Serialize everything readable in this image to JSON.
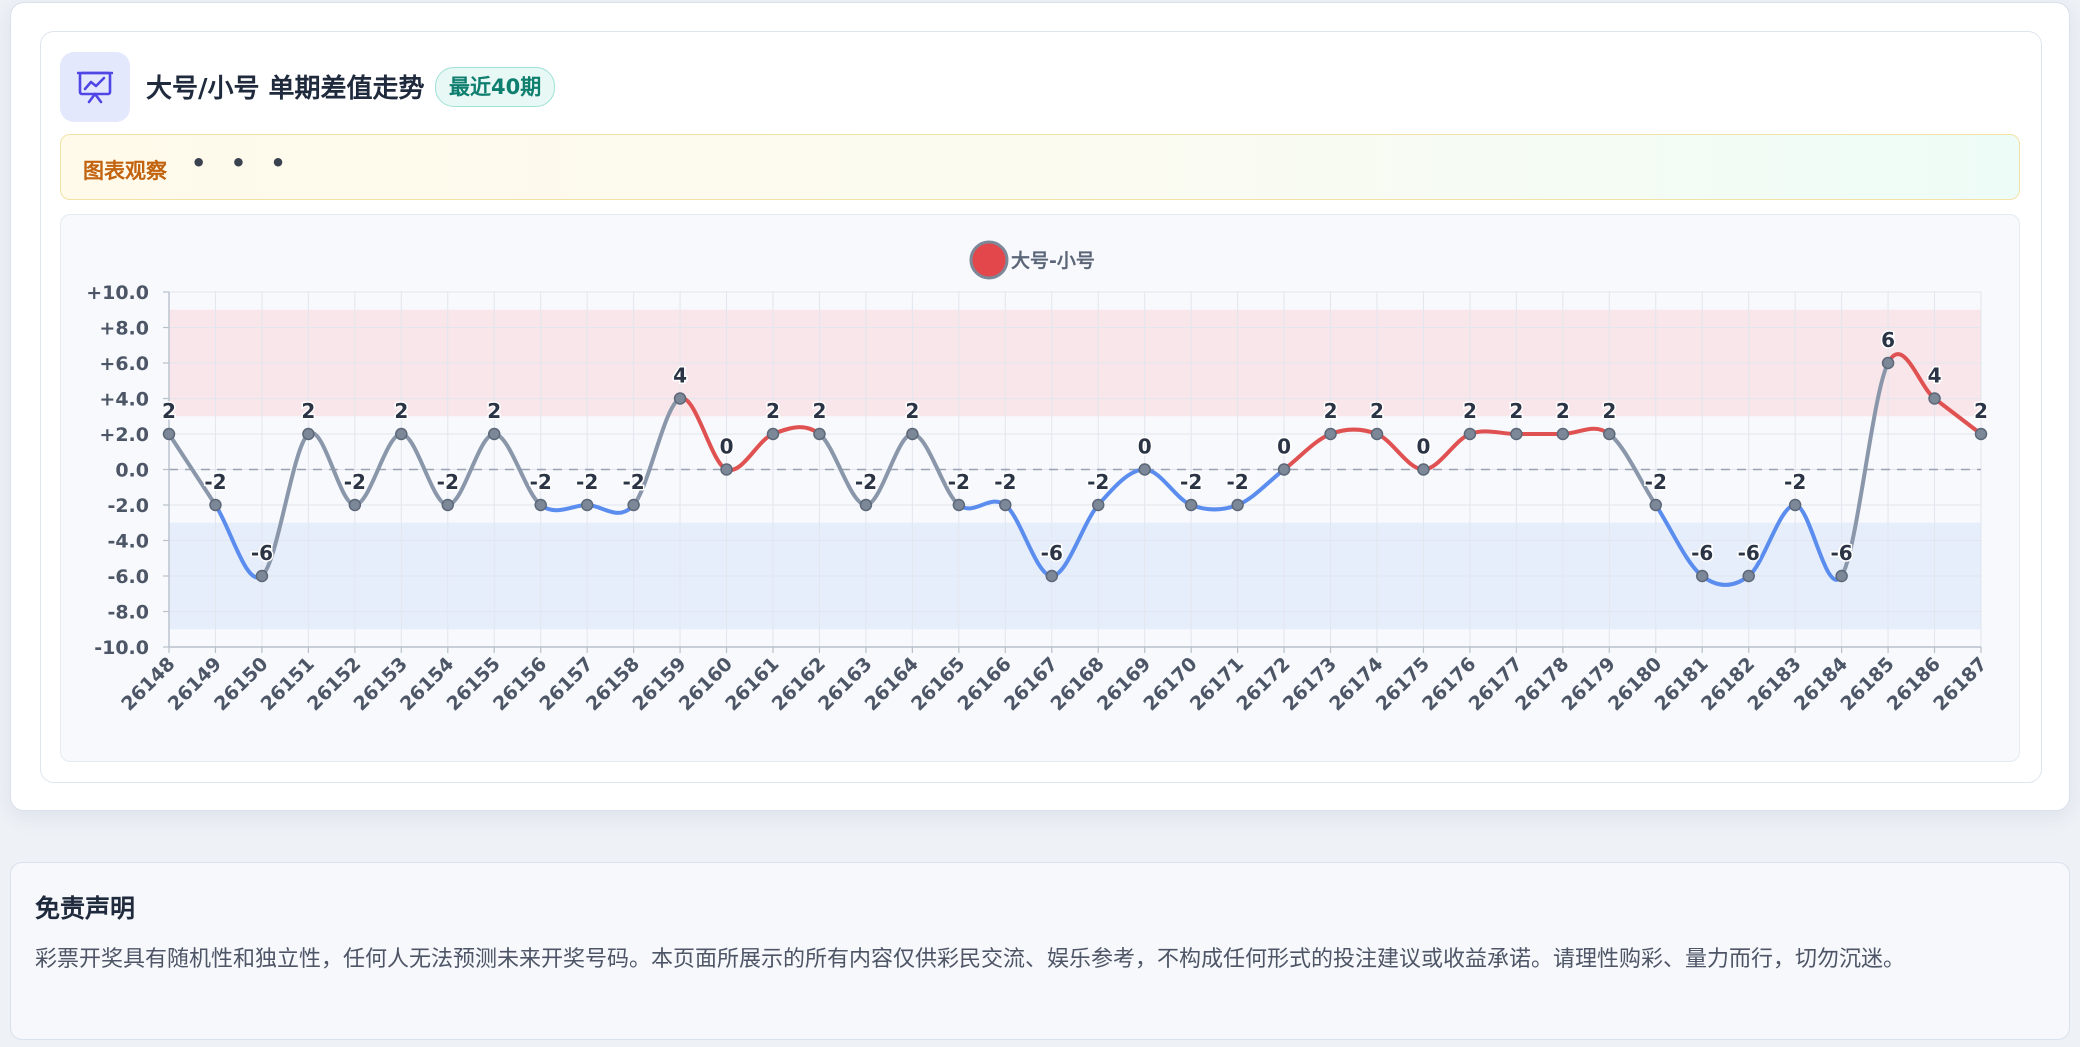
{
  "header": {
    "title": "大号/小号 单期差值走势",
    "badge": "最近40期",
    "icon": "chart-presentation-icon"
  },
  "observation": {
    "label": "图表观察",
    "dots": "• • •"
  },
  "disclaimer": {
    "title": "免责声明",
    "text": "彩票开奖具有随机性和独立性，任何人无法预测未来开奖号码。本页面所展示的所有内容仅供彩民交流、娱乐参考，不构成任何形式的投注建议或收益承诺。请理性购彩、量力而行，切勿沉迷。"
  },
  "colors": {
    "positive": "#e05252",
    "negative": "#5b8def",
    "neutral": "#8a97aa",
    "positive_band": "#f9e6ea",
    "negative_band": "#e7eefb",
    "zero_line": "#9aa3b2",
    "legend_fill": "#e3474b"
  },
  "chart_data": {
    "type": "line",
    "title": "",
    "xlabel": "",
    "ylabel": "",
    "legend": "大号-小号",
    "legend_position": "top",
    "ylim": [
      -10,
      10
    ],
    "y_tick_step": 2,
    "y_tick_labels": [
      "+10.0",
      "+8.0",
      "+6.0",
      "+4.0",
      "+2.0",
      "0.0",
      "-2.0",
      "-4.0",
      "-6.0",
      "-8.0",
      "-10.0"
    ],
    "bands": [
      {
        "from": 3,
        "to": 9,
        "color": "#f9e6ea"
      },
      {
        "from": -9,
        "to": -3,
        "color": "#e7eefb"
      }
    ],
    "grid": true,
    "x": [
      "26148",
      "26149",
      "26150",
      "26151",
      "26152",
      "26153",
      "26154",
      "26155",
      "26156",
      "26157",
      "26158",
      "26159",
      "26160",
      "26161",
      "26162",
      "26163",
      "26164",
      "26165",
      "26166",
      "26167",
      "26168",
      "26169",
      "26170",
      "26171",
      "26172",
      "26173",
      "26174",
      "26175",
      "26176",
      "26177",
      "26178",
      "26179",
      "26180",
      "26181",
      "26182",
      "26183",
      "26184",
      "26185",
      "26186",
      "26187"
    ],
    "series": [
      {
        "name": "大号-小号",
        "values": [
          2,
          -2,
          -6,
          2,
          -2,
          2,
          -2,
          2,
          -2,
          -2,
          -2,
          4,
          0,
          2,
          2,
          -2,
          2,
          -2,
          -2,
          -6,
          -2,
          0,
          -2,
          -2,
          0,
          2,
          2,
          0,
          2,
          2,
          2,
          2,
          -2,
          -6,
          -6,
          -2,
          -6,
          6,
          4,
          2
        ]
      }
    ]
  }
}
